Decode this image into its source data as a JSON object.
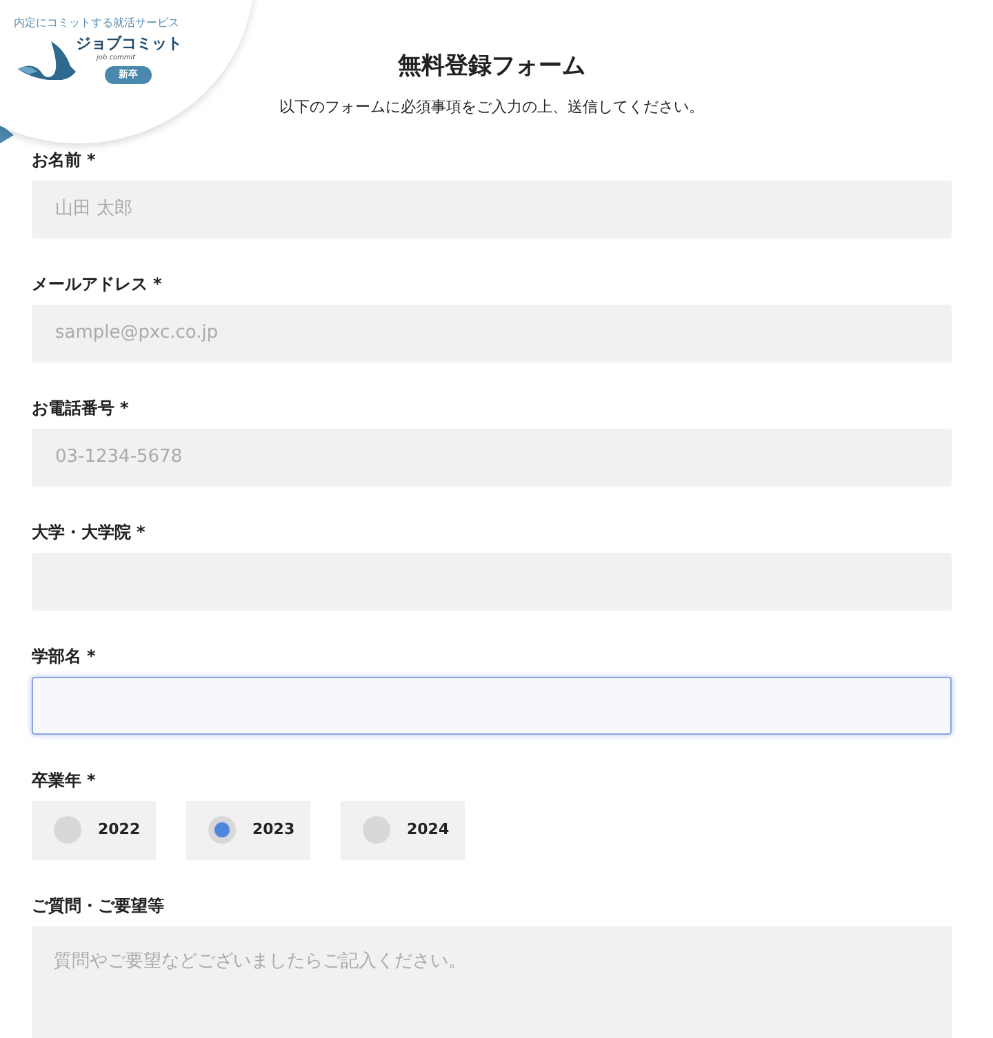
{
  "logo": {
    "tagline": "内定にコミットする就活サービス",
    "name": "ジョブコミット",
    "name_roman": "job commit",
    "badge": "新卒"
  },
  "form": {
    "title": "無料登録フォーム",
    "description": "以下のフォームに必須事項をご入力の上、送信してください。",
    "fields": [
      {
        "kind": "text",
        "label": "お名前",
        "mark": "*",
        "placeholder": "山田 太郎",
        "focused": false
      },
      {
        "kind": "text",
        "label": "メールアドレス",
        "mark": "*",
        "placeholder": "sample@pxc.co.jp",
        "focused": false
      },
      {
        "kind": "text",
        "label": "お電話番号",
        "mark": "*",
        "placeholder": "03-1234-5678",
        "focused": false
      },
      {
        "kind": "text",
        "label": "大学・大学院",
        "mark": "*",
        "focused": false
      },
      {
        "kind": "text",
        "label": "学部名",
        "mark": "*",
        "focused": true
      },
      {
        "kind": "radio",
        "label": "卒業年",
        "mark": "*",
        "options": [
          {
            "label": "2022",
            "selected": false
          },
          {
            "label": "2023",
            "selected": true
          },
          {
            "label": "2024",
            "selected": false
          }
        ]
      },
      {
        "kind": "textarea",
        "label": "ご質問・ご要望等",
        "placeholder": "質問やご要望などございましたらご記入ください。",
        "focused": false
      }
    ]
  }
}
